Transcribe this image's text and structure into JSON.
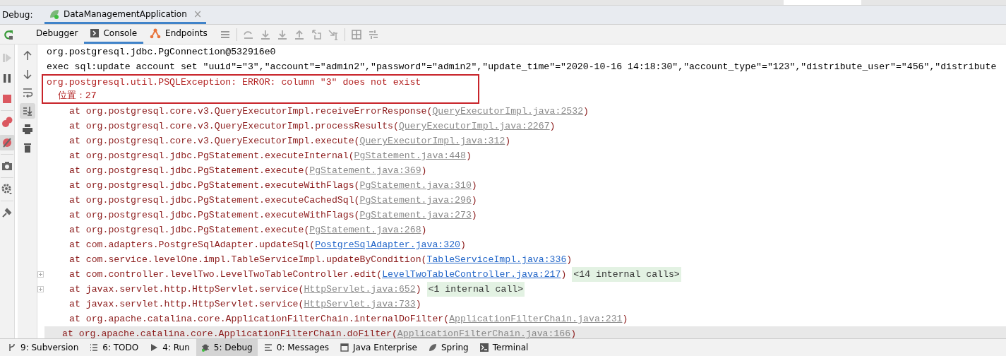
{
  "debug_bar": {
    "label": "Debug:",
    "session_tab": {
      "title": "DataManagementApplication",
      "close": "×",
      "selected": true
    }
  },
  "toolbar": {
    "tabs": [
      {
        "label": "Debugger",
        "selected": false
      },
      {
        "label": "Console",
        "selected": true
      },
      {
        "label": "Endpoints",
        "selected": false
      }
    ]
  },
  "console": {
    "lines": [
      {
        "kind": "plain",
        "text": "org.postgresql.jdbc.PgConnection@532916e0"
      },
      {
        "kind": "plain",
        "text": "exec sql:update account set \"uuid\"=\"3\",\"account\"=\"admin2\",\"password\"=\"admin2\",\"update_time\"=\"2020-10-16 14:18:30\",\"account_type\"=\"123\",\"distribute_user\"=\"456\",\"distribute"
      },
      {
        "kind": "error",
        "lines": [
          "org.postgresql.util.PSQLException: ERROR: column \"3\" does not exist",
          "  位置：27"
        ]
      },
      {
        "kind": "library_frame",
        "text": "at org.postgresql.core.v3.QueryExecutorImpl.receiveErrorResponse(",
        "link": "QueryExecutorImpl.java:2532",
        "suffix": ")",
        "expandable": false,
        "highlighted": false
      },
      {
        "kind": "library_frame",
        "text": "at org.postgresql.core.v3.QueryExecutorImpl.processResults(",
        "link": "QueryExecutorImpl.java:2267",
        "suffix": ")",
        "expandable": false,
        "highlighted": false
      },
      {
        "kind": "library_frame",
        "text": "at org.postgresql.core.v3.QueryExecutorImpl.execute(",
        "link": "QueryExecutorImpl.java:312",
        "suffix": ")",
        "expandable": false,
        "highlighted": false
      },
      {
        "kind": "library_frame",
        "text": "at org.postgresql.jdbc.PgStatement.executeInternal(",
        "link": "PgStatement.java:448",
        "suffix": ")",
        "expandable": false,
        "highlighted": false
      },
      {
        "kind": "library_frame",
        "text": "at org.postgresql.jdbc.PgStatement.execute(",
        "link": "PgStatement.java:369",
        "suffix": ")",
        "expandable": false,
        "highlighted": false
      },
      {
        "kind": "library_frame",
        "text": "at org.postgresql.jdbc.PgStatement.executeWithFlags(",
        "link": "PgStatement.java:310",
        "suffix": ")",
        "expandable": false,
        "highlighted": false
      },
      {
        "kind": "library_frame",
        "text": "at org.postgresql.jdbc.PgStatement.executeCachedSql(",
        "link": "PgStatement.java:296",
        "suffix": ")",
        "expandable": false,
        "highlighted": false
      },
      {
        "kind": "library_frame",
        "text": "at org.postgresql.jdbc.PgStatement.executeWithFlags(",
        "link": "PgStatement.java:273",
        "suffix": ")",
        "expandable": false,
        "highlighted": false
      },
      {
        "kind": "library_frame",
        "text": "at org.postgresql.jdbc.PgStatement.execute(",
        "link": "PgStatement.java:268",
        "suffix": ")",
        "expandable": false,
        "highlighted": false
      },
      {
        "kind": "project_frame",
        "text": "at com.adapters.PostgreSqlAdapter.updateSql(",
        "link": "PostgreSqlAdapter.java:320",
        "suffix": ")",
        "expandable": false,
        "highlighted": false
      },
      {
        "kind": "project_frame",
        "text": "at com.service.levelOne.impl.TableServiceImpl.updateByCondition(",
        "link": "TableServiceImpl.java:336",
        "suffix": ")",
        "expandable": false,
        "highlighted": false
      },
      {
        "kind": "project_frame",
        "text": "at com.controller.levelTwo.LevelTwoTableController.edit(",
        "link": "LevelTwoTableController.java:217",
        "suffix": ")",
        "internal": "<14 internal calls>",
        "expandable": true,
        "highlighted": false
      },
      {
        "kind": "library_frame",
        "text": "at javax.servlet.http.HttpServlet.service(",
        "link": "HttpServlet.java:652",
        "suffix": ")",
        "internal": "<1 internal call>",
        "expandable": true,
        "highlighted": false
      },
      {
        "kind": "library_frame",
        "text": "at javax.servlet.http.HttpServlet.service(",
        "link": "HttpServlet.java:733",
        "suffix": ")",
        "expandable": false,
        "highlighted": false
      },
      {
        "kind": "library_frame",
        "text": "at org.apache.catalina.core.ApplicationFilterChain.internalDoFilter(",
        "link": "ApplicationFilterChain.java:231",
        "suffix": ")",
        "expandable": false,
        "highlighted": false
      },
      {
        "kind": "library_frame",
        "text": "at org.apache.catalina.core.ApplicationFilterChain.doFilter(",
        "link": "ApplicationFilterChain.java:166",
        "suffix": ")",
        "expandable": false,
        "highlighted": true
      }
    ]
  },
  "bottom_tools": [
    {
      "label": "9: Subversion",
      "selected": false
    },
    {
      "label": "6: TODO",
      "selected": false
    },
    {
      "label": "4: Run",
      "selected": false
    },
    {
      "label": "5: Debug",
      "selected": true
    },
    {
      "label": "0: Messages",
      "selected": false
    },
    {
      "label": "Java Enterprise",
      "selected": false
    },
    {
      "label": "Spring",
      "selected": false
    },
    {
      "label": "Terminal",
      "selected": false
    }
  ]
}
